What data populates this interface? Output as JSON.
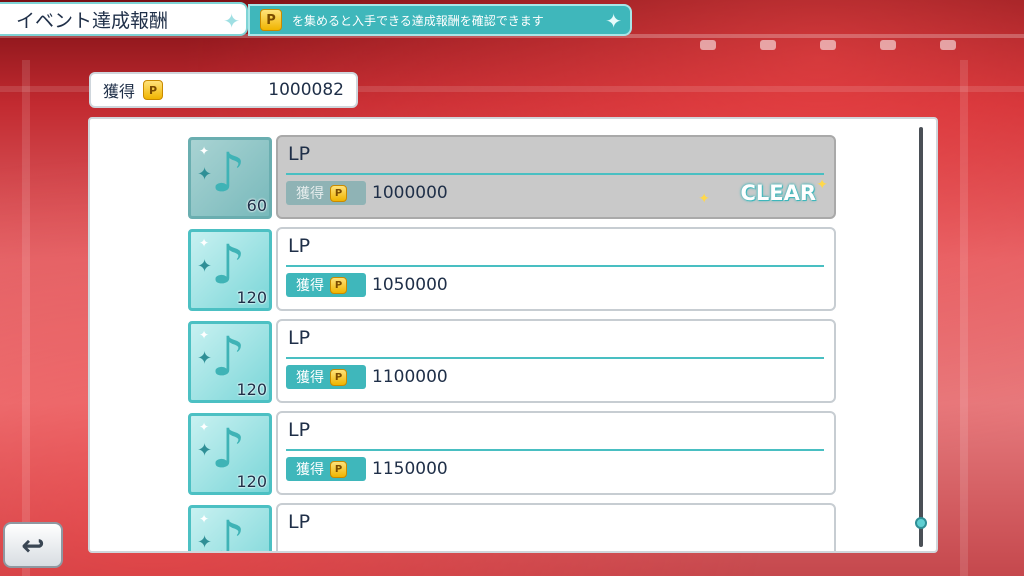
{
  "header": {
    "title": "イベント達成報酬",
    "hint_badge": "P",
    "hint": "を集めると入手できる達成報酬を確認できます"
  },
  "points": {
    "label": "獲得",
    "badge": "P",
    "value": "1000082"
  },
  "rewards": [
    {
      "name": "LP",
      "req_label": "獲得",
      "badge": "P",
      "required": "1000000",
      "count": "60",
      "status": "CLEAR"
    },
    {
      "name": "LP",
      "req_label": "獲得",
      "badge": "P",
      "required": "1050000",
      "count": "120"
    },
    {
      "name": "LP",
      "req_label": "獲得",
      "badge": "P",
      "required": "1100000",
      "count": "120"
    },
    {
      "name": "LP",
      "req_label": "獲得",
      "badge": "P",
      "required": "1150000",
      "count": "120"
    },
    {
      "name": "LP"
    }
  ],
  "icons": {
    "reward": "music-note-icon",
    "back": "back-arrow-icon",
    "sparkle": "sparkle-icon"
  },
  "colors": {
    "accent": "#3fb7bb",
    "badge": "#f0b400",
    "cleared_card": "#c9c9c9"
  },
  "scroll": {
    "position": 1.0
  }
}
